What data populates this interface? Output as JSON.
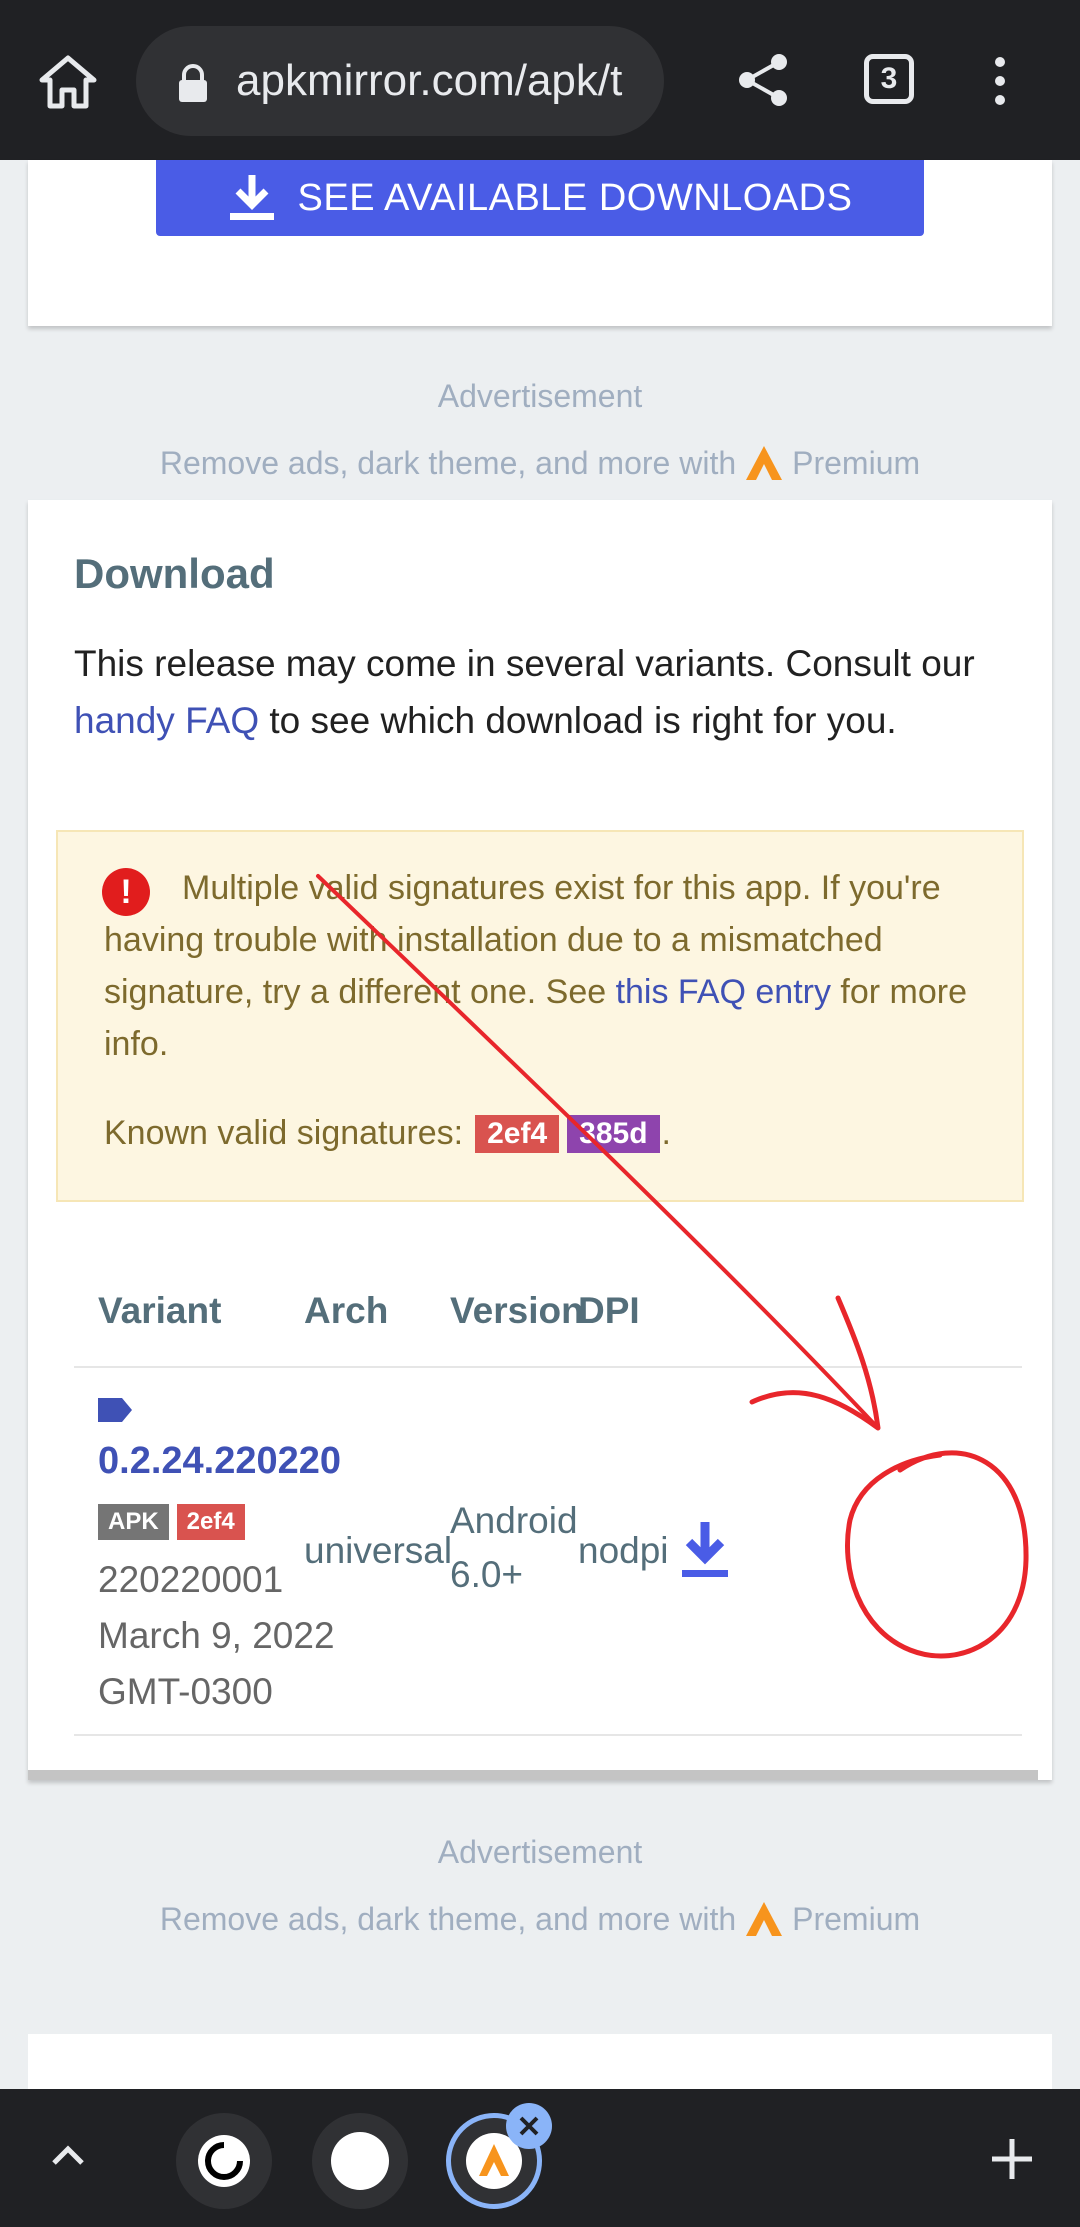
{
  "browser": {
    "url": "apkmirror.com/apk/t",
    "tab_count": "3"
  },
  "top_card": {
    "button_label": "SEE AVAILABLE DOWNLOADS"
  },
  "ads": {
    "label": "Advertisement",
    "premium_text": "Remove ads, dark theme, and more with",
    "premium_word": "Premium"
  },
  "download": {
    "title": "Download",
    "desc_before": "This release may come in several variants. Consult our ",
    "desc_link": "handy FAQ",
    "desc_after": " to see which download is right for you.",
    "warning": {
      "text_before": "Multiple valid signatures exist for this app. If you're having trouble with installation due to a mismatched signature, try a different one. See ",
      "link": "this FAQ entry",
      "text_after": " for more info.",
      "signatures_label": "Known valid signatures:",
      "signatures": [
        {
          "text": "2ef4",
          "color": "#d9534f"
        },
        {
          "text": "385d",
          "color": "#8e44ad"
        }
      ],
      "signatures_end": "."
    },
    "table": {
      "headers": [
        "Variant",
        "Arch",
        "Version",
        "DPI"
      ],
      "rows": [
        {
          "variant": "0.2.24.220220",
          "badge_apk": "APK",
          "badge_sig": "2ef4",
          "code": "220220001",
          "date": "March 9, 2022",
          "tz": "GMT-0300",
          "arch": "universal",
          "version_line1": "Android",
          "version_line2": "6.0+",
          "dpi": "nodpi"
        }
      ]
    }
  },
  "colors": {
    "accent": "#4a5ce6",
    "annotation": "#e8262b"
  }
}
